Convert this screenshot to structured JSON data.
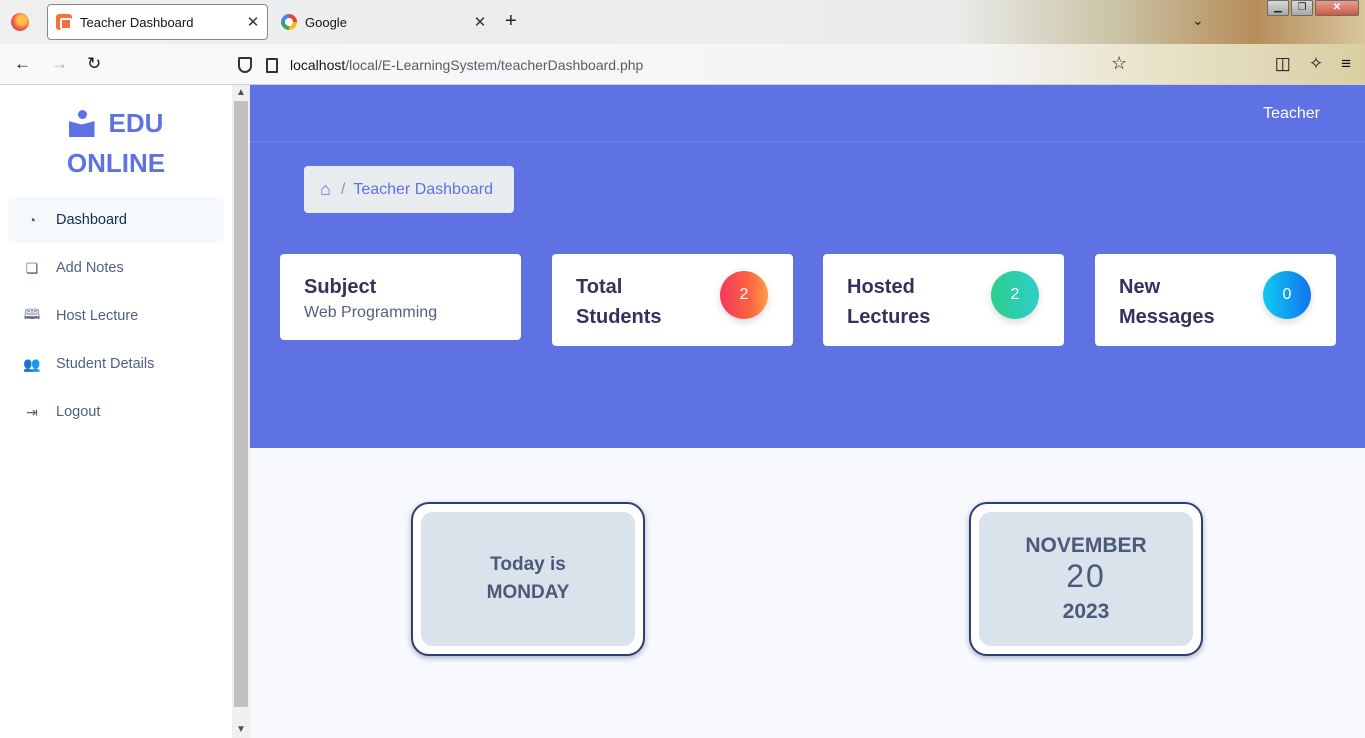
{
  "browser": {
    "tabs": [
      {
        "title": "Teacher Dashboard",
        "active": true
      },
      {
        "title": "Google",
        "active": false
      }
    ],
    "url_host": "localhost",
    "url_path": "/local/E-LearningSystem/teacherDashboard.php"
  },
  "sidebar": {
    "brand_line1": "EDU",
    "brand_line2": "ONLINE",
    "items": [
      {
        "label": "Dashboard",
        "icon": "dashboard-icon",
        "active": true
      },
      {
        "label": "Add Notes",
        "icon": "notes-icon"
      },
      {
        "label": "Host Lecture",
        "icon": "book-icon"
      },
      {
        "label": "Student Details",
        "icon": "users-icon"
      },
      {
        "label": "Logout",
        "icon": "logout-icon"
      }
    ]
  },
  "header": {
    "user": "Teacher",
    "breadcrumb": "Teacher Dashboard"
  },
  "cards": {
    "subject": {
      "title": "Subject",
      "value": "Web Programming"
    },
    "students": {
      "title_line1": "Total",
      "title_line2": "Students",
      "count": "2",
      "color": "#f5653a"
    },
    "lectures": {
      "title_line1": "Hosted",
      "title_line2": "Lectures",
      "count": "2",
      "color": "#2dce89"
    },
    "messages": {
      "title_line1": "New",
      "title_line2": "Messages",
      "count": "0",
      "color": "#11a4ef"
    }
  },
  "day_box": {
    "line1": "Today is",
    "line2": "MONDAY"
  },
  "date_box": {
    "month": "NOVEMBER",
    "day": "20",
    "year": "2023"
  },
  "colors": {
    "primary": "#5e72e4",
    "light": "#f8f9fe"
  }
}
